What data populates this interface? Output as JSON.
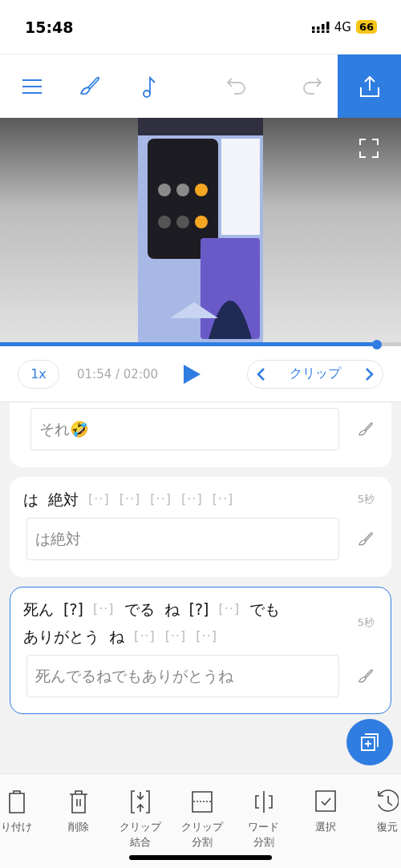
{
  "status_bar": {
    "time": "15:48",
    "network": "4G",
    "battery": "66"
  },
  "toolbar": {
    "buttons": [
      {
        "kind": "menu"
      },
      {
        "kind": "brush"
      },
      {
        "kind": "music"
      },
      {
        "kind": "undo",
        "disabled": true
      },
      {
        "kind": "redo",
        "disabled": true
      },
      {
        "kind": "export"
      }
    ]
  },
  "player": {
    "progress": {
      "level": 0.94
    },
    "speed": "1x",
    "time": "01:54 / 02:00",
    "clip_label": "クリップ"
  },
  "segments": [
    {
      "selected": false,
      "value": "それ🤣"
    },
    {
      "selected": false,
      "duration": "5秒",
      "value": "は絶対",
      "tokens": [
        {
          "kind": "word",
          "text": "は"
        },
        {
          "kind": "word",
          "text": "絶対"
        },
        {
          "kind": "gap",
          "text": "[··]"
        },
        {
          "kind": "gap",
          "text": "[··]"
        },
        {
          "kind": "gap",
          "text": "[··]"
        },
        {
          "kind": "gap",
          "text": "[··]"
        },
        {
          "kind": "gap",
          "text": "[··]"
        }
      ]
    },
    {
      "selected": true,
      "duration": "5秒",
      "value": "死んでるねでもありがとうね",
      "tokens": [
        {
          "kind": "word",
          "text": "死ん"
        },
        {
          "kind": "word",
          "text": "[?]"
        },
        {
          "kind": "gap",
          "text": "[··]"
        },
        {
          "kind": "word",
          "text": "でる"
        },
        {
          "kind": "word",
          "text": "ね"
        },
        {
          "kind": "word",
          "text": "[?]"
        },
        {
          "kind": "gap",
          "text": "[··]"
        },
        {
          "kind": "word",
          "text": "でも"
        },
        {
          "kind": "word",
          "text": "ありがとう"
        },
        {
          "kind": "word",
          "text": "ね"
        },
        {
          "kind": "gap",
          "text": "[··]"
        },
        {
          "kind": "gap",
          "text": "[··]"
        },
        {
          "kind": "gap",
          "text": "[··]"
        }
      ]
    }
  ],
  "tools": [
    {
      "kind": "paste",
      "lines": [
        "り付け"
      ]
    },
    {
      "kind": "delete",
      "lines": [
        "削除"
      ]
    },
    {
      "kind": "merge",
      "lines": [
        "クリップ",
        "結合"
      ]
    },
    {
      "kind": "split",
      "lines": [
        "クリップ",
        "分割"
      ]
    },
    {
      "kind": "word-split",
      "lines": [
        "ワード",
        "分割"
      ]
    },
    {
      "kind": "select",
      "lines": [
        "選択"
      ]
    },
    {
      "kind": "restore",
      "lines": [
        "復元"
      ]
    }
  ]
}
